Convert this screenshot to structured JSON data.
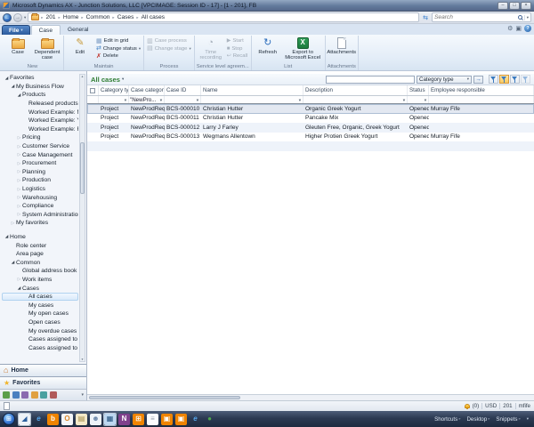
{
  "window": {
    "title": "Microsoft Dynamics AX - Junction Solutions, LLC [VPCIMAGE: Session ID - 17] - [1 - 201], FB",
    "controls": [
      {
        "name": "minimize-button",
        "glyph": "–"
      },
      {
        "name": "restore-button",
        "glyph": "□"
      },
      {
        "name": "close-button",
        "glyph": "×"
      }
    ]
  },
  "address_bar": {
    "breadcrumb": [
      "201",
      "Home",
      "Common",
      "Cases",
      "All cases"
    ],
    "search_placeholder": "Search"
  },
  "top_right_icons": [
    "view-settings-icon",
    "window-icon",
    "help-icon"
  ],
  "ribbon": {
    "file_button": "File",
    "tabs": [
      {
        "label": "Case",
        "active": true
      },
      {
        "label": "General",
        "active": false
      }
    ],
    "groups": [
      {
        "label": "New",
        "buttons": [
          {
            "label": "Case",
            "icon": "case",
            "size": "big"
          },
          {
            "label": "Dependent case",
            "icon": "dependent-case",
            "size": "big"
          }
        ]
      },
      {
        "label": "Maintain",
        "buttons": [
          {
            "label": "Edit",
            "icon": "edit",
            "size": "big"
          },
          {
            "label": "Edit in grid",
            "icon": "edit-in-grid",
            "size": "small"
          },
          {
            "label": "Change status",
            "icon": "change-status",
            "size": "small",
            "dropdown": true
          },
          {
            "label": "Delete",
            "icon": "delete",
            "size": "small"
          }
        ]
      },
      {
        "label": "Process",
        "buttons": [
          {
            "label": "Case process",
            "icon": "case-process",
            "size": "small",
            "disabled": true
          },
          {
            "label": "Change stage",
            "icon": "change-stage",
            "size": "small",
            "disabled": true,
            "dropdown": true
          }
        ]
      },
      {
        "label": "Service level agreem...",
        "buttons": [
          {
            "label": "Time recording",
            "icon": "time-recording",
            "size": "big",
            "disabled": true
          },
          {
            "label": "Start",
            "icon": "start",
            "size": "small",
            "disabled": true
          },
          {
            "label": "Stop",
            "icon": "stop",
            "size": "small",
            "disabled": true
          },
          {
            "label": "Recall",
            "icon": "recall",
            "size": "small",
            "disabled": true
          }
        ]
      },
      {
        "label": "List",
        "buttons": [
          {
            "label": "Refresh",
            "icon": "refresh",
            "size": "big"
          },
          {
            "label": "Export to Microsoft Excel",
            "icon": "export-excel",
            "size": "big"
          }
        ]
      },
      {
        "label": "Attachments",
        "buttons": [
          {
            "label": "Attachments",
            "icon": "attachments",
            "size": "big"
          }
        ]
      }
    ]
  },
  "action_pane_strip": {
    "title": "All cases",
    "filter_input": "",
    "filter_scope": "Category type",
    "filter_buttons": [
      {
        "name": "filter-by-selection-button",
        "state": "normal"
      },
      {
        "name": "filter-by-grid-button",
        "state": "active"
      },
      {
        "name": "advanced-filter-button",
        "state": "normal"
      },
      {
        "name": "remove-filter-button",
        "state": "dim"
      }
    ]
  },
  "grid": {
    "columns": [
      "Category type",
      "Case category",
      "Case ID",
      "Name",
      "Description",
      "Status",
      "Employee responsible"
    ],
    "filter_row": [
      "",
      "\"NewPro...",
      "",
      "",
      "",
      "",
      ""
    ],
    "rows": [
      [
        "Project",
        "NewProdReq",
        "BCS-000010",
        "Christian Hutter",
        "Organic Greek Yogurt",
        "Opened",
        "Murray Fife"
      ],
      [
        "Project",
        "NewProdReq",
        "BCS-000011",
        "Christian Hutter",
        "Pancake Mix",
        "Opened",
        ""
      ],
      [
        "Project",
        "NewProdReq",
        "BCS-000012",
        "Larry J Farley",
        "Gleuten Free, Organic, Greek Yogurt",
        "Opened",
        ""
      ],
      [
        "Project",
        "NewProdReq",
        "BCS-000013",
        "Wegmans Allentown",
        "Higher Protien Greek Yogurt",
        "Opened",
        "Murray Fife"
      ]
    ],
    "selected_row": 0
  },
  "sidebar": {
    "favorites_tree": [
      {
        "label": "Favorites",
        "level": 0,
        "state": "expanded"
      },
      {
        "label": "My Business Flow",
        "level": 1,
        "state": "expanded"
      },
      {
        "label": "Products",
        "level": 2,
        "state": "expanded"
      },
      {
        "label": "Released products",
        "level": 3,
        "state": "none"
      },
      {
        "label": "Worked Example: Milk",
        "level": 3,
        "state": "none"
      },
      {
        "label": "Worked Example: Yogurt",
        "level": 3,
        "state": "none"
      },
      {
        "label": "Worked Example: Raspbe",
        "level": 3,
        "state": "none"
      },
      {
        "label": "Pricing",
        "level": 2,
        "state": "collapsed"
      },
      {
        "label": "Customer Service",
        "level": 2,
        "state": "collapsed"
      },
      {
        "label": "Case Management",
        "level": 2,
        "state": "collapsed"
      },
      {
        "label": "Procurement",
        "level": 2,
        "state": "collapsed"
      },
      {
        "label": "Planning",
        "level": 2,
        "state": "collapsed"
      },
      {
        "label": "Production",
        "level": 2,
        "state": "collapsed"
      },
      {
        "label": "Logistics",
        "level": 2,
        "state": "collapsed"
      },
      {
        "label": "Warehousing",
        "level": 2,
        "state": "collapsed"
      },
      {
        "label": "Compliance",
        "level": 2,
        "state": "collapsed"
      },
      {
        "label": "System Administration",
        "level": 2,
        "state": "collapsed"
      },
      {
        "label": "My favorites",
        "level": 1,
        "state": "collapsed"
      }
    ],
    "home_tree": [
      {
        "label": "Home",
        "level": 0,
        "state": "expanded"
      },
      {
        "label": "Role center",
        "level": 1,
        "state": "none"
      },
      {
        "label": "Area page",
        "level": 1,
        "state": "none"
      },
      {
        "label": "Common",
        "level": 1,
        "state": "expanded"
      },
      {
        "label": "Global address book",
        "level": 2,
        "state": "none"
      },
      {
        "label": "Work items",
        "level": 2,
        "state": "collapsed"
      },
      {
        "label": "Cases",
        "level": 2,
        "state": "expanded"
      },
      {
        "label": "All cases",
        "level": 3,
        "state": "none",
        "selected": true
      },
      {
        "label": "My cases",
        "level": 3,
        "state": "none"
      },
      {
        "label": "My open cases",
        "level": 3,
        "state": "none"
      },
      {
        "label": "Open cases",
        "level": 3,
        "state": "none"
      },
      {
        "label": "My overdue cases",
        "level": 3,
        "state": "none"
      },
      {
        "label": "Cases assigned to me",
        "level": 3,
        "state": "none"
      },
      {
        "label": "Cases assigned to my qu",
        "level": 3,
        "state": "none"
      }
    ],
    "bands": [
      {
        "label": "Home",
        "icon": "home-icon"
      },
      {
        "label": "Favorites",
        "icon": "star-icon"
      }
    ],
    "module_buttons": [
      "module-icon-1",
      "module-icon-2",
      "module-icon-3",
      "module-icon-4",
      "module-icon-5",
      "module-icon-6"
    ]
  },
  "status_bar": {
    "alerts_count": "(0)",
    "currency": "USD",
    "company": "201",
    "user": "mfife"
  },
  "taskbar": {
    "icons": [
      {
        "name": "dynamics-ax",
        "active": true
      },
      {
        "name": "internet-explorer",
        "active": false
      },
      {
        "name": "bing",
        "active": false
      },
      {
        "name": "outlook",
        "active": false
      },
      {
        "name": "documents-library",
        "active": false
      },
      {
        "name": "contacts",
        "active": false
      },
      {
        "name": "dynamics-ax-window",
        "active": true
      },
      {
        "name": "onenote",
        "active": false
      },
      {
        "name": "app-tiles",
        "active": false
      },
      {
        "name": "notepad",
        "active": false
      },
      {
        "name": "org-chart",
        "active": false
      },
      {
        "name": "org-chart-2",
        "active": false
      },
      {
        "name": "internet-explorer-2",
        "active": false
      },
      {
        "name": "communicator",
        "active": false
      }
    ],
    "toolbars": [
      "Shortcuts",
      "Desktop",
      "Snippets"
    ]
  },
  "colors": {
    "title_green": "#2e7d32",
    "ribbon_blue": "#dfe9f6",
    "selection_blue": "#d6e8fa",
    "taskbar_dark": "#2c3a52",
    "filter_active_orange": "#f8c860"
  }
}
